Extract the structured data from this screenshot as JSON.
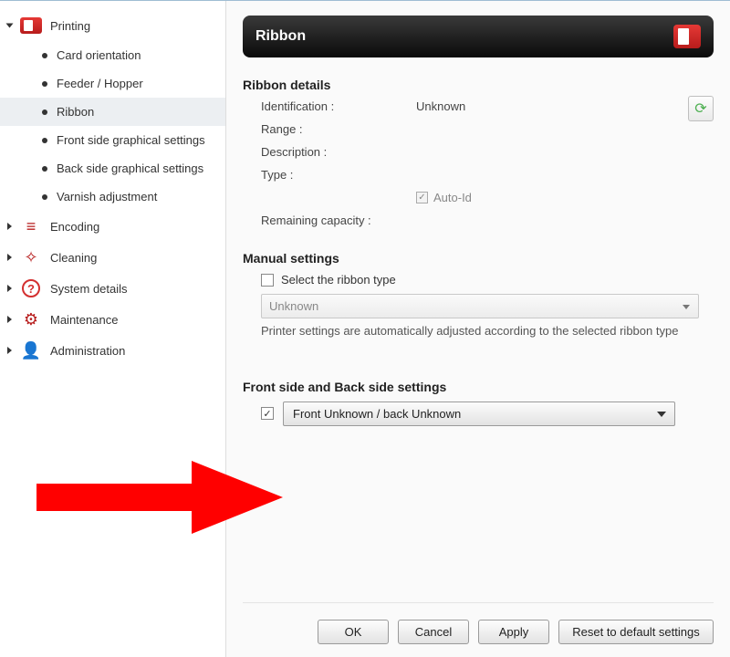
{
  "sidebar": {
    "printing": {
      "label": "Printing",
      "items": [
        {
          "label": "Card orientation"
        },
        {
          "label": "Feeder / Hopper"
        },
        {
          "label": "Ribbon"
        },
        {
          "label": "Front side graphical settings"
        },
        {
          "label": "Back side graphical settings"
        },
        {
          "label": "Varnish adjustment"
        }
      ]
    },
    "encoding": {
      "label": "Encoding"
    },
    "cleaning": {
      "label": "Cleaning"
    },
    "system": {
      "label": "System details"
    },
    "maintenance": {
      "label": "Maintenance"
    },
    "admin": {
      "label": "Administration"
    }
  },
  "header": {
    "title": "Ribbon"
  },
  "ribbon_details": {
    "title": "Ribbon details",
    "identification_label": "Identification :",
    "identification_value": "Unknown",
    "range_label": "Range :",
    "description_label": "Description :",
    "type_label": "Type :",
    "auto_id_label": "Auto-Id",
    "remaining_label": "Remaining capacity :"
  },
  "manual": {
    "title": "Manual settings",
    "select_label": "Select the ribbon  type",
    "combo_value": "Unknown",
    "hint": "Printer settings are automatically adjusted according to the selected ribbon type"
  },
  "sides": {
    "title": "Front side and Back side settings",
    "combo_value": "Front Unknown / back Unknown"
  },
  "buttons": {
    "ok": "OK",
    "cancel": "Cancel",
    "apply": "Apply",
    "reset": "Reset to default settings"
  }
}
